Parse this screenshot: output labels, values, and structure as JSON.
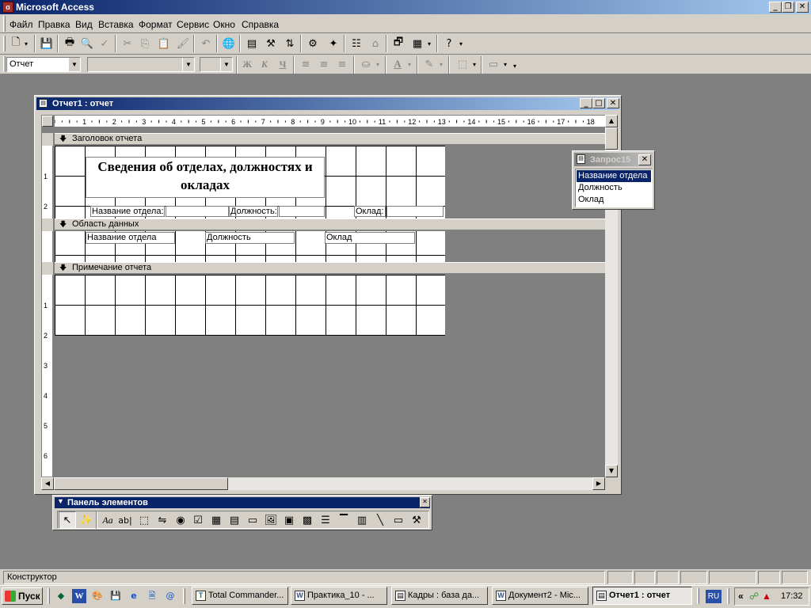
{
  "app": {
    "title": "Microsoft Access"
  },
  "menu": [
    {
      "id": "file",
      "label": "Файл"
    },
    {
      "id": "edit",
      "label": "Правка"
    },
    {
      "id": "view",
      "label": "Вид"
    },
    {
      "id": "insert",
      "label": "Вставка"
    },
    {
      "id": "format",
      "label": "Формат"
    },
    {
      "id": "tools",
      "label": "Сервис"
    },
    {
      "id": "window",
      "label": "Окно"
    },
    {
      "id": "help",
      "label": "Справка"
    }
  ],
  "formatting": {
    "object_value": "Отчет",
    "font_value": "",
    "size_value": "",
    "bold": "Ж",
    "italic": "К",
    "underline": "Ч"
  },
  "report_window": {
    "title": "Отчет1 : отчет",
    "ruler_numbers": [
      "1",
      "2",
      "3",
      "4",
      "5",
      "6",
      "7",
      "8",
      "9",
      "10",
      "11",
      "12",
      "13",
      "14",
      "15",
      "16",
      "17",
      "18"
    ],
    "vruler_numbers": [
      "1",
      "2",
      "1",
      "2",
      "3",
      "4",
      "5",
      "6"
    ],
    "sections": {
      "header": "Заголовок отчета",
      "detail": "Область данных",
      "footer": "Примечание отчета"
    },
    "header_title": "Сведения об отделах, должностях и окладах",
    "header_labels": {
      "dept": "Название отдела:",
      "position": "Должность:",
      "salary": "Оклад:"
    },
    "detail_fields": {
      "dept": "Название отдела",
      "position": "Должность",
      "salary": "Оклад"
    }
  },
  "field_list": {
    "title": "Запрос15",
    "items": [
      {
        "label": "Название отдела",
        "selected": true
      },
      {
        "label": "Должность",
        "selected": false
      },
      {
        "label": "Оклад",
        "selected": false
      }
    ]
  },
  "toolbox": {
    "title": "Панель элементов"
  },
  "status": {
    "text": "Конструктор"
  },
  "taskbar": {
    "start": "Пуск",
    "tasks": [
      {
        "label": "Total Commander...",
        "active": false
      },
      {
        "label": "Практика_10 - ...",
        "active": false
      },
      {
        "label": "Кадры : база да...",
        "active": false
      },
      {
        "label": "Документ2 - Mic...",
        "active": false
      },
      {
        "label": "Отчет1 : отчет",
        "active": true
      }
    ],
    "lang": "RU",
    "clock": "17:32"
  }
}
